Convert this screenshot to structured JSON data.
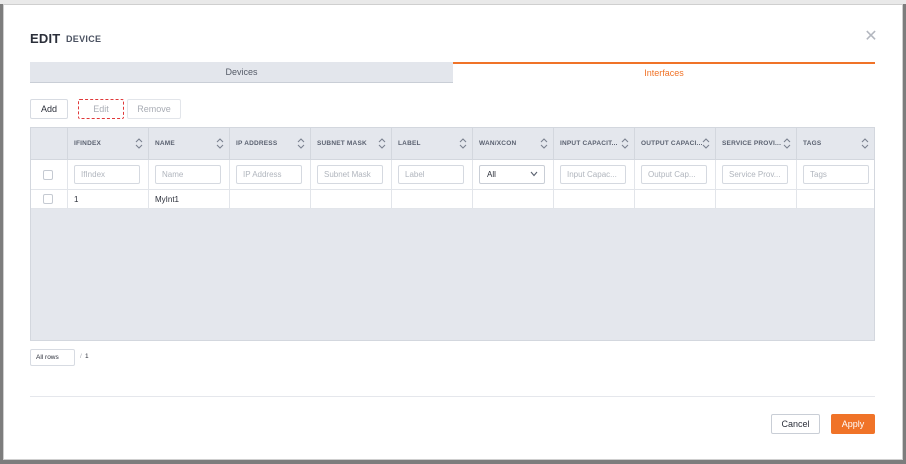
{
  "dialog": {
    "title": "EDIT",
    "subtitle": "DEVICE"
  },
  "tabs": [
    {
      "label": "Devices",
      "active": false
    },
    {
      "label": "Interfaces",
      "active": true
    }
  ],
  "toolbar": {
    "add_label": "Add",
    "edit_label": "Edit",
    "remove_label": "Remove"
  },
  "table": {
    "columns": [
      "IFINDEX",
      "NAME",
      "IP ADDRESS",
      "SUBNET MASK",
      "LABEL",
      "WAN/XCON",
      "INPUT CAPACIT...",
      "OUTPUT CAPACI...",
      "SERVICE PROVI...",
      "TAGS"
    ],
    "filter_placeholders": [
      "IfIndex",
      "Name",
      "IP Address",
      "Subnet Mask",
      "Label",
      "",
      "Input Capac...",
      "Output Cap...",
      "Service Prov...",
      "Tags"
    ],
    "wan_filter_value": "All",
    "rows": [
      [
        "1",
        "MyInt1",
        "",
        "",
        "",
        "",
        "",
        "",
        "",
        ""
      ]
    ]
  },
  "pagination": {
    "rows_option": "All rows",
    "separator": "/",
    "total_pages": "1"
  },
  "footer": {
    "cancel_label": "Cancel",
    "apply_label": "Apply"
  },
  "colors": {
    "accent": "#f07328",
    "header_bg": "#e4e7ed",
    "highlight": "#e0393a"
  }
}
